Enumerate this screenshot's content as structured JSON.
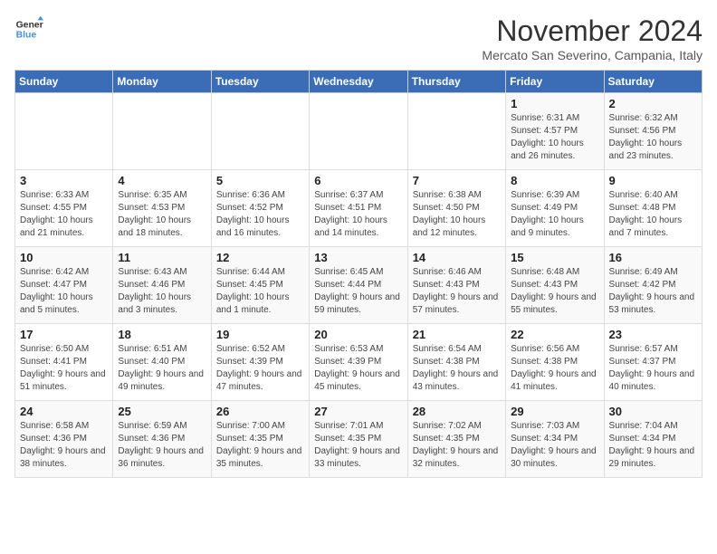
{
  "logo": {
    "line1": "General",
    "line2": "Blue"
  },
  "title": "November 2024",
  "subtitle": "Mercato San Severino, Campania, Italy",
  "weekdays": [
    "Sunday",
    "Monday",
    "Tuesday",
    "Wednesday",
    "Thursday",
    "Friday",
    "Saturday"
  ],
  "weeks": [
    [
      {
        "day": "",
        "info": ""
      },
      {
        "day": "",
        "info": ""
      },
      {
        "day": "",
        "info": ""
      },
      {
        "day": "",
        "info": ""
      },
      {
        "day": "",
        "info": ""
      },
      {
        "day": "1",
        "info": "Sunrise: 6:31 AM\nSunset: 4:57 PM\nDaylight: 10 hours and 26 minutes."
      },
      {
        "day": "2",
        "info": "Sunrise: 6:32 AM\nSunset: 4:56 PM\nDaylight: 10 hours and 23 minutes."
      }
    ],
    [
      {
        "day": "3",
        "info": "Sunrise: 6:33 AM\nSunset: 4:55 PM\nDaylight: 10 hours and 21 minutes."
      },
      {
        "day": "4",
        "info": "Sunrise: 6:35 AM\nSunset: 4:53 PM\nDaylight: 10 hours and 18 minutes."
      },
      {
        "day": "5",
        "info": "Sunrise: 6:36 AM\nSunset: 4:52 PM\nDaylight: 10 hours and 16 minutes."
      },
      {
        "day": "6",
        "info": "Sunrise: 6:37 AM\nSunset: 4:51 PM\nDaylight: 10 hours and 14 minutes."
      },
      {
        "day": "7",
        "info": "Sunrise: 6:38 AM\nSunset: 4:50 PM\nDaylight: 10 hours and 12 minutes."
      },
      {
        "day": "8",
        "info": "Sunrise: 6:39 AM\nSunset: 4:49 PM\nDaylight: 10 hours and 9 minutes."
      },
      {
        "day": "9",
        "info": "Sunrise: 6:40 AM\nSunset: 4:48 PM\nDaylight: 10 hours and 7 minutes."
      }
    ],
    [
      {
        "day": "10",
        "info": "Sunrise: 6:42 AM\nSunset: 4:47 PM\nDaylight: 10 hours and 5 minutes."
      },
      {
        "day": "11",
        "info": "Sunrise: 6:43 AM\nSunset: 4:46 PM\nDaylight: 10 hours and 3 minutes."
      },
      {
        "day": "12",
        "info": "Sunrise: 6:44 AM\nSunset: 4:45 PM\nDaylight: 10 hours and 1 minute."
      },
      {
        "day": "13",
        "info": "Sunrise: 6:45 AM\nSunset: 4:44 PM\nDaylight: 9 hours and 59 minutes."
      },
      {
        "day": "14",
        "info": "Sunrise: 6:46 AM\nSunset: 4:43 PM\nDaylight: 9 hours and 57 minutes."
      },
      {
        "day": "15",
        "info": "Sunrise: 6:48 AM\nSunset: 4:43 PM\nDaylight: 9 hours and 55 minutes."
      },
      {
        "day": "16",
        "info": "Sunrise: 6:49 AM\nSunset: 4:42 PM\nDaylight: 9 hours and 53 minutes."
      }
    ],
    [
      {
        "day": "17",
        "info": "Sunrise: 6:50 AM\nSunset: 4:41 PM\nDaylight: 9 hours and 51 minutes."
      },
      {
        "day": "18",
        "info": "Sunrise: 6:51 AM\nSunset: 4:40 PM\nDaylight: 9 hours and 49 minutes."
      },
      {
        "day": "19",
        "info": "Sunrise: 6:52 AM\nSunset: 4:39 PM\nDaylight: 9 hours and 47 minutes."
      },
      {
        "day": "20",
        "info": "Sunrise: 6:53 AM\nSunset: 4:39 PM\nDaylight: 9 hours and 45 minutes."
      },
      {
        "day": "21",
        "info": "Sunrise: 6:54 AM\nSunset: 4:38 PM\nDaylight: 9 hours and 43 minutes."
      },
      {
        "day": "22",
        "info": "Sunrise: 6:56 AM\nSunset: 4:38 PM\nDaylight: 9 hours and 41 minutes."
      },
      {
        "day": "23",
        "info": "Sunrise: 6:57 AM\nSunset: 4:37 PM\nDaylight: 9 hours and 40 minutes."
      }
    ],
    [
      {
        "day": "24",
        "info": "Sunrise: 6:58 AM\nSunset: 4:36 PM\nDaylight: 9 hours and 38 minutes."
      },
      {
        "day": "25",
        "info": "Sunrise: 6:59 AM\nSunset: 4:36 PM\nDaylight: 9 hours and 36 minutes."
      },
      {
        "day": "26",
        "info": "Sunrise: 7:00 AM\nSunset: 4:35 PM\nDaylight: 9 hours and 35 minutes."
      },
      {
        "day": "27",
        "info": "Sunrise: 7:01 AM\nSunset: 4:35 PM\nDaylight: 9 hours and 33 minutes."
      },
      {
        "day": "28",
        "info": "Sunrise: 7:02 AM\nSunset: 4:35 PM\nDaylight: 9 hours and 32 minutes."
      },
      {
        "day": "29",
        "info": "Sunrise: 7:03 AM\nSunset: 4:34 PM\nDaylight: 9 hours and 30 minutes."
      },
      {
        "day": "30",
        "info": "Sunrise: 7:04 AM\nSunset: 4:34 PM\nDaylight: 9 hours and 29 minutes."
      }
    ]
  ]
}
